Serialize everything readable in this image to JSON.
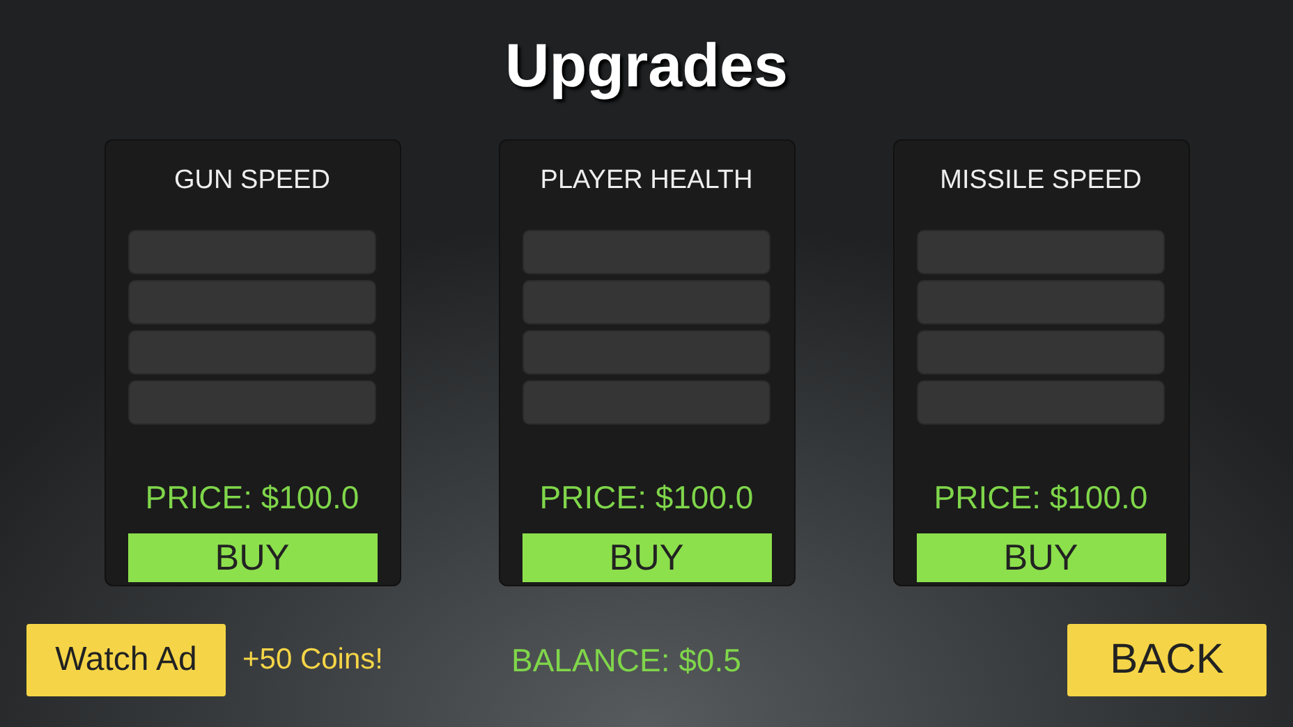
{
  "title": "Upgrades",
  "upgrades": [
    {
      "name": "GUN SPEED",
      "slots": [
        {
          "filled": false
        },
        {
          "filled": false
        },
        {
          "filled": false
        },
        {
          "filled": false
        }
      ],
      "price": "PRICE: $100.0",
      "button": "BUY"
    },
    {
      "name": "PLAYER HEALTH",
      "slots": [
        {
          "filled": false
        },
        {
          "filled": false
        },
        {
          "filled": false
        },
        {
          "filled": false
        }
      ],
      "price": "PRICE: $100.0",
      "button": "BUY"
    },
    {
      "name": "MISSILE SPEED",
      "slots": [
        {
          "filled": false
        },
        {
          "filled": false
        },
        {
          "filled": false
        },
        {
          "filled": false
        }
      ],
      "price": "PRICE: $100.0",
      "button": "BUY"
    }
  ],
  "watch_ad": {
    "button": "Watch Ad",
    "reward": "+50 Coins!"
  },
  "balance": "BALANCE: $0.5",
  "back_button": "BACK"
}
